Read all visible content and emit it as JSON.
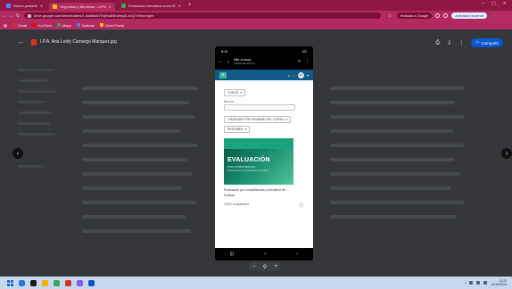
{
  "browser": {
    "tabs": [
      {
        "label": "Nueva pestaña",
        "active": false
      },
      {
        "label": "Seguridad y Bienestar - UPN",
        "active": true
      },
      {
        "label": "Evaluación formativa curso M",
        "active": false
      }
    ],
    "url": "drive.google.com/drive/folders/1-9aW8ckTRqRs8NKhrbpZL4vQ7cRewVgtm",
    "guest_label": "Invitado a Google",
    "profile_label": "Actividad reciente",
    "bookmarks": [
      {
        "label": "Gmail",
        "color": "#d93025"
      },
      {
        "label": "YouTube",
        "color": "#ff0000"
      },
      {
        "label": "Maps",
        "color": "#34a853"
      },
      {
        "label": "Noticias",
        "color": "#4285f4"
      },
      {
        "label": "Drive Portal",
        "color": "#fbbc04"
      }
    ]
  },
  "preview": {
    "file_name": "I.P.A. Ana Leidy Camargo Marquez.jpg",
    "share_label": "Compartir"
  },
  "phone": {
    "status_time": "9:41",
    "status_right": "4G",
    "page_title": "Mis cursos",
    "page_url": "aulavirtual.edu.co",
    "user_initials": "AC",
    "filter_all": "TODOS",
    "search_label": "Buscar",
    "sort_label": "ORDENAR POR NOMBRE DEL CURSO",
    "view_label": "RESUMEN",
    "course_image_title": "EVALUACIÓN",
    "course_image_subtitle": "POR COMPETENCIAS",
    "course_image_tagline": "Evaluación por competencias y formativa",
    "course_title": "Evaluación por competencias y formativa de...",
    "course_category": "Evaluar",
    "progress_label": "100% completado"
  },
  "taskbar": {
    "time": "12:22",
    "date": "14/10/2024",
    "apps": [
      "#2c7be5",
      "#1a1a1a",
      "#f4b400",
      "#3aa757",
      "#d93025",
      "#7b61ff",
      "#0b57d0"
    ]
  }
}
